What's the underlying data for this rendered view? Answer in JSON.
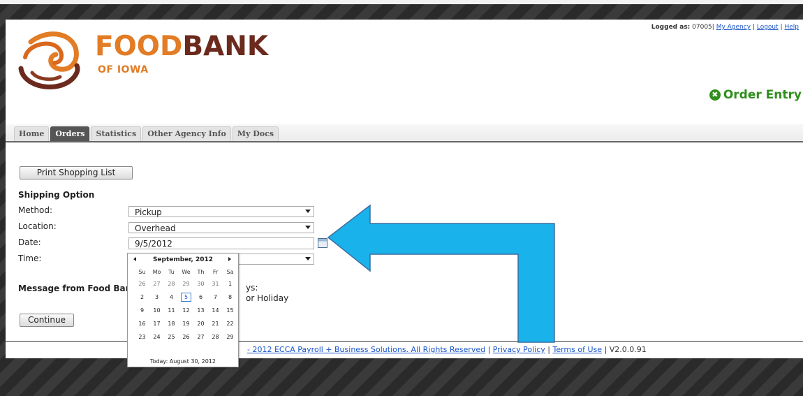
{
  "brand": {
    "main_food": "FOOD",
    "main_bank": "BANK",
    "sub": "OF IOWA"
  },
  "userbar": {
    "logged_label": "Logged as:",
    "user": "07005|",
    "my_agency": "My Agency",
    "sep1": "|",
    "logout": "Logout",
    "sep2": "|",
    "help": "Help"
  },
  "header": {
    "order_entry": "Order Entry"
  },
  "tabs": [
    {
      "label": "Home"
    },
    {
      "label": "Orders"
    },
    {
      "label": "Statistics"
    },
    {
      "label": "Other Agency Info"
    },
    {
      "label": "My Docs"
    }
  ],
  "buttons": {
    "print": "Print Shopping List",
    "continue": "Continue"
  },
  "shipping": {
    "title": "Shipping Option",
    "method_label": "Method:",
    "method_value": "Pickup",
    "location_label": "Location:",
    "location_value": "Overhead",
    "date_label": "Date:",
    "date_value": "9/5/2012",
    "time_label": "Time:"
  },
  "message": {
    "label": "Message from Food Bank:",
    "line1_fragment": "ys:",
    "line2_fragment": "or Holiday"
  },
  "calendar": {
    "month": "September, 2012",
    "dow": [
      "Su",
      "Mo",
      "Tu",
      "We",
      "Th",
      "Fr",
      "Sa"
    ],
    "weeks": [
      [
        "26",
        "27",
        "28",
        "29",
        "30",
        "31",
        "1"
      ],
      [
        "2",
        "3",
        "4",
        "5",
        "6",
        "7",
        "8"
      ],
      [
        "9",
        "10",
        "11",
        "12",
        "13",
        "14",
        "15"
      ],
      [
        "16",
        "17",
        "18",
        "19",
        "20",
        "21",
        "22"
      ],
      [
        "23",
        "24",
        "25",
        "26",
        "27",
        "28",
        "29"
      ]
    ],
    "selected": "5",
    "today": "Today: August 30, 2012"
  },
  "footer": {
    "copyright": "- 2012 ECCA Payroll + Business Solutions. All Rights Reserved",
    "sep": "|",
    "privacy": "Privacy Policy",
    "terms": "Terms of Use",
    "version": "V2.0.0.91"
  },
  "colors": {
    "accent_green": "#2f8f1c",
    "brand_orange": "#e27c25",
    "brand_brown": "#6b2a1d",
    "arrow_blue": "#1ab2ea"
  }
}
